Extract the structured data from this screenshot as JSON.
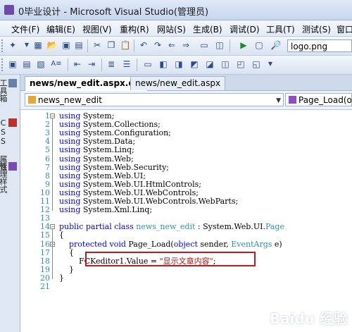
{
  "window": {
    "title": "0毕业设计 - Microsoft Visual Studio(管理员)"
  },
  "menu": {
    "items": [
      "文件(F)",
      "编辑(E)",
      "视图(V)",
      "重构(R)",
      "网站(S)",
      "生成(B)",
      "调试(D)",
      "工具(T)",
      "测试(S)",
      "窗口"
    ]
  },
  "toolbar": {
    "find_value": "logo.png"
  },
  "sidepanel": {
    "tabs": [
      "工具箱",
      "CSS 属性",
      "管理样式"
    ]
  },
  "tabs": [
    {
      "label": "news/new_edit.aspx.cs*",
      "active": true
    },
    {
      "label": "news/new_edit.aspx",
      "active": false
    }
  ],
  "navbar": {
    "class_combo": "news_new_edit",
    "member_combo": "Page_Load(obj"
  },
  "code": {
    "line_numbers": [
      "1",
      "2",
      "3",
      "4",
      "5",
      "6",
      "7",
      "8",
      "9",
      "10",
      "11",
      "12",
      "13",
      "14",
      "15",
      "16",
      "17",
      "18",
      "19",
      "20",
      "21"
    ],
    "lines": [
      [
        {
          "t": "using",
          "c": "kw"
        },
        {
          "t": " System;"
        }
      ],
      [
        {
          "t": "using",
          "c": "kw"
        },
        {
          "t": " System.Collections;"
        }
      ],
      [
        {
          "t": "using",
          "c": "kw"
        },
        {
          "t": " System.Configuration;"
        }
      ],
      [
        {
          "t": "using",
          "c": "kw"
        },
        {
          "t": " System.Data;"
        }
      ],
      [
        {
          "t": "using",
          "c": "kw"
        },
        {
          "t": " System.Linq;"
        }
      ],
      [
        {
          "t": "using",
          "c": "kw"
        },
        {
          "t": " System.Web;"
        }
      ],
      [
        {
          "t": "using",
          "c": "kw"
        },
        {
          "t": " System.Web.Security;"
        }
      ],
      [
        {
          "t": "using",
          "c": "kw"
        },
        {
          "t": " System.Web.UI;"
        }
      ],
      [
        {
          "t": "using",
          "c": "kw"
        },
        {
          "t": " System.Web.UI.HtmlControls;"
        }
      ],
      [
        {
          "t": "using",
          "c": "kw"
        },
        {
          "t": " System.Web.UI.WebControls;"
        }
      ],
      [
        {
          "t": "using",
          "c": "kw"
        },
        {
          "t": " System.Web.UI.WebControls.WebParts;"
        }
      ],
      [
        {
          "t": "using",
          "c": "kw"
        },
        {
          "t": " System.Xml.Linq;"
        }
      ],
      [],
      [
        {
          "t": "public partial class ",
          "c": "kw"
        },
        {
          "t": "news_new_edit",
          "c": "ty"
        },
        {
          "t": " : System.Web.UI."
        },
        {
          "t": "Page",
          "c": "ty"
        }
      ],
      [
        {
          "t": "{"
        }
      ],
      [
        {
          "t": "    "
        },
        {
          "t": "protected void",
          "c": "kw"
        },
        {
          "t": " Page_Load("
        },
        {
          "t": "object",
          "c": "kw"
        },
        {
          "t": " sender, "
        },
        {
          "t": "EventArgs",
          "c": "ty"
        },
        {
          "t": " e)"
        }
      ],
      [
        {
          "t": "    {"
        }
      ],
      [
        {
          "t": "        FCKeditor1.Value = "
        },
        {
          "t": "\"显示文章内容\"",
          "c": "str"
        },
        {
          "t": ";"
        }
      ],
      [
        {
          "t": "    }"
        }
      ],
      [
        {
          "t": "}"
        }
      ],
      []
    ]
  },
  "watermark": "Baidu 经验"
}
